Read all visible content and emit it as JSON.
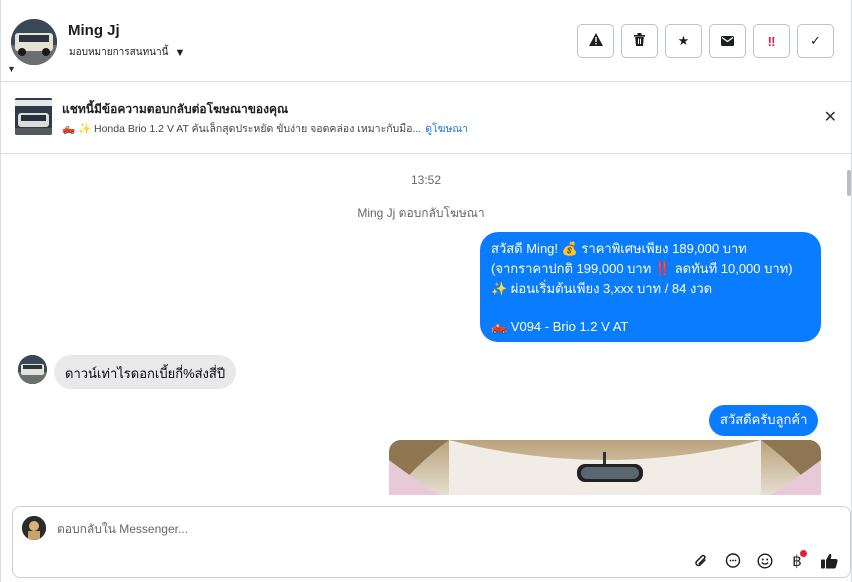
{
  "header": {
    "contact_name": "Ming Jj",
    "assign_label": "มอบหมายการสนทนานี้",
    "actions": [
      {
        "name": "report-button",
        "icon": "warning-icon",
        "glyph": "⚠"
      },
      {
        "name": "delete-button",
        "icon": "trash-icon",
        "glyph": "🗑"
      },
      {
        "name": "star-button",
        "icon": "star-icon",
        "glyph": "★"
      },
      {
        "name": "mail-button",
        "icon": "envelope-icon",
        "glyph": "✉"
      },
      {
        "name": "spam-button",
        "icon": "double-exclamation-icon",
        "glyph": "‼"
      },
      {
        "name": "done-button",
        "icon": "check-icon",
        "glyph": "✓"
      }
    ]
  },
  "ad_banner": {
    "title": "แชทนี้มีข้อความตอบกลับต่อโฆษณาของคุณ",
    "subtitle": "🛻 ✨ Honda Brio 1.2 V AT คันเล็กสุดประหยัด ขับง่าย จอดคล่อง เหมาะกับมือ...",
    "link": "ดูโฆษณา",
    "close_icon": "close-icon"
  },
  "conversation": {
    "timestamp": "13:52",
    "reply_note": "Ming Jj ตอบกลับโฆษณา",
    "outgoing_1": {
      "line1": "สวัสดี Ming! 💰 ราคาพิเศษเพียง 189,000 บาท",
      "line2": "(จากราคาปกติ 199,000 บาท ‼️ ลดทันที 10,000 บาท)",
      "line3": "✨ ผ่อนเริ่มต้นเพียง 3,xxx บาท / 84 งวด",
      "line4": "🛻 V094 - Brio 1.2 V AT"
    },
    "incoming_1": "ดาวน์เท่าไรดอกเบี้ยกี่%ส่งสี่ปี",
    "outgoing_2": "สวัสดีครับลูกค้า"
  },
  "composer": {
    "placeholder": "ตอบกลับใน Messenger...",
    "tools": [
      "paperclip-icon",
      "chat-bubble-icon",
      "emoji-icon",
      "baht-icon",
      "thumbs-up-icon"
    ]
  },
  "colors": {
    "outgoing_bubble": "#0a7cff",
    "incoming_bubble": "#e9e9ec",
    "link": "#1b74e4",
    "alert_red": "#e41e3f"
  }
}
